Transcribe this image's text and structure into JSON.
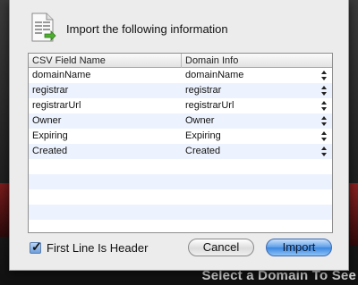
{
  "backdrop": {
    "text": "Select a Domain To See"
  },
  "dialog": {
    "title": "Import the following information",
    "icon": "document-import-icon"
  },
  "table": {
    "columns": [
      "CSV Field Name",
      "Domain Info"
    ],
    "rows": [
      {
        "field": "domainName",
        "mapping": "domainName"
      },
      {
        "field": "registrar",
        "mapping": "registrar"
      },
      {
        "field": "registrarUrl",
        "mapping": "registrarUrl"
      },
      {
        "field": "Owner",
        "mapping": "Owner"
      },
      {
        "field": "Expiring",
        "mapping": "Expiring"
      },
      {
        "field": "Created",
        "mapping": "Created"
      }
    ],
    "alternate_row_color": "#edf3fe"
  },
  "controls": {
    "first_line_header_label": "First Line Is Header",
    "first_line_header_checked": true,
    "cancel_label": "Cancel",
    "import_label": "Import"
  }
}
